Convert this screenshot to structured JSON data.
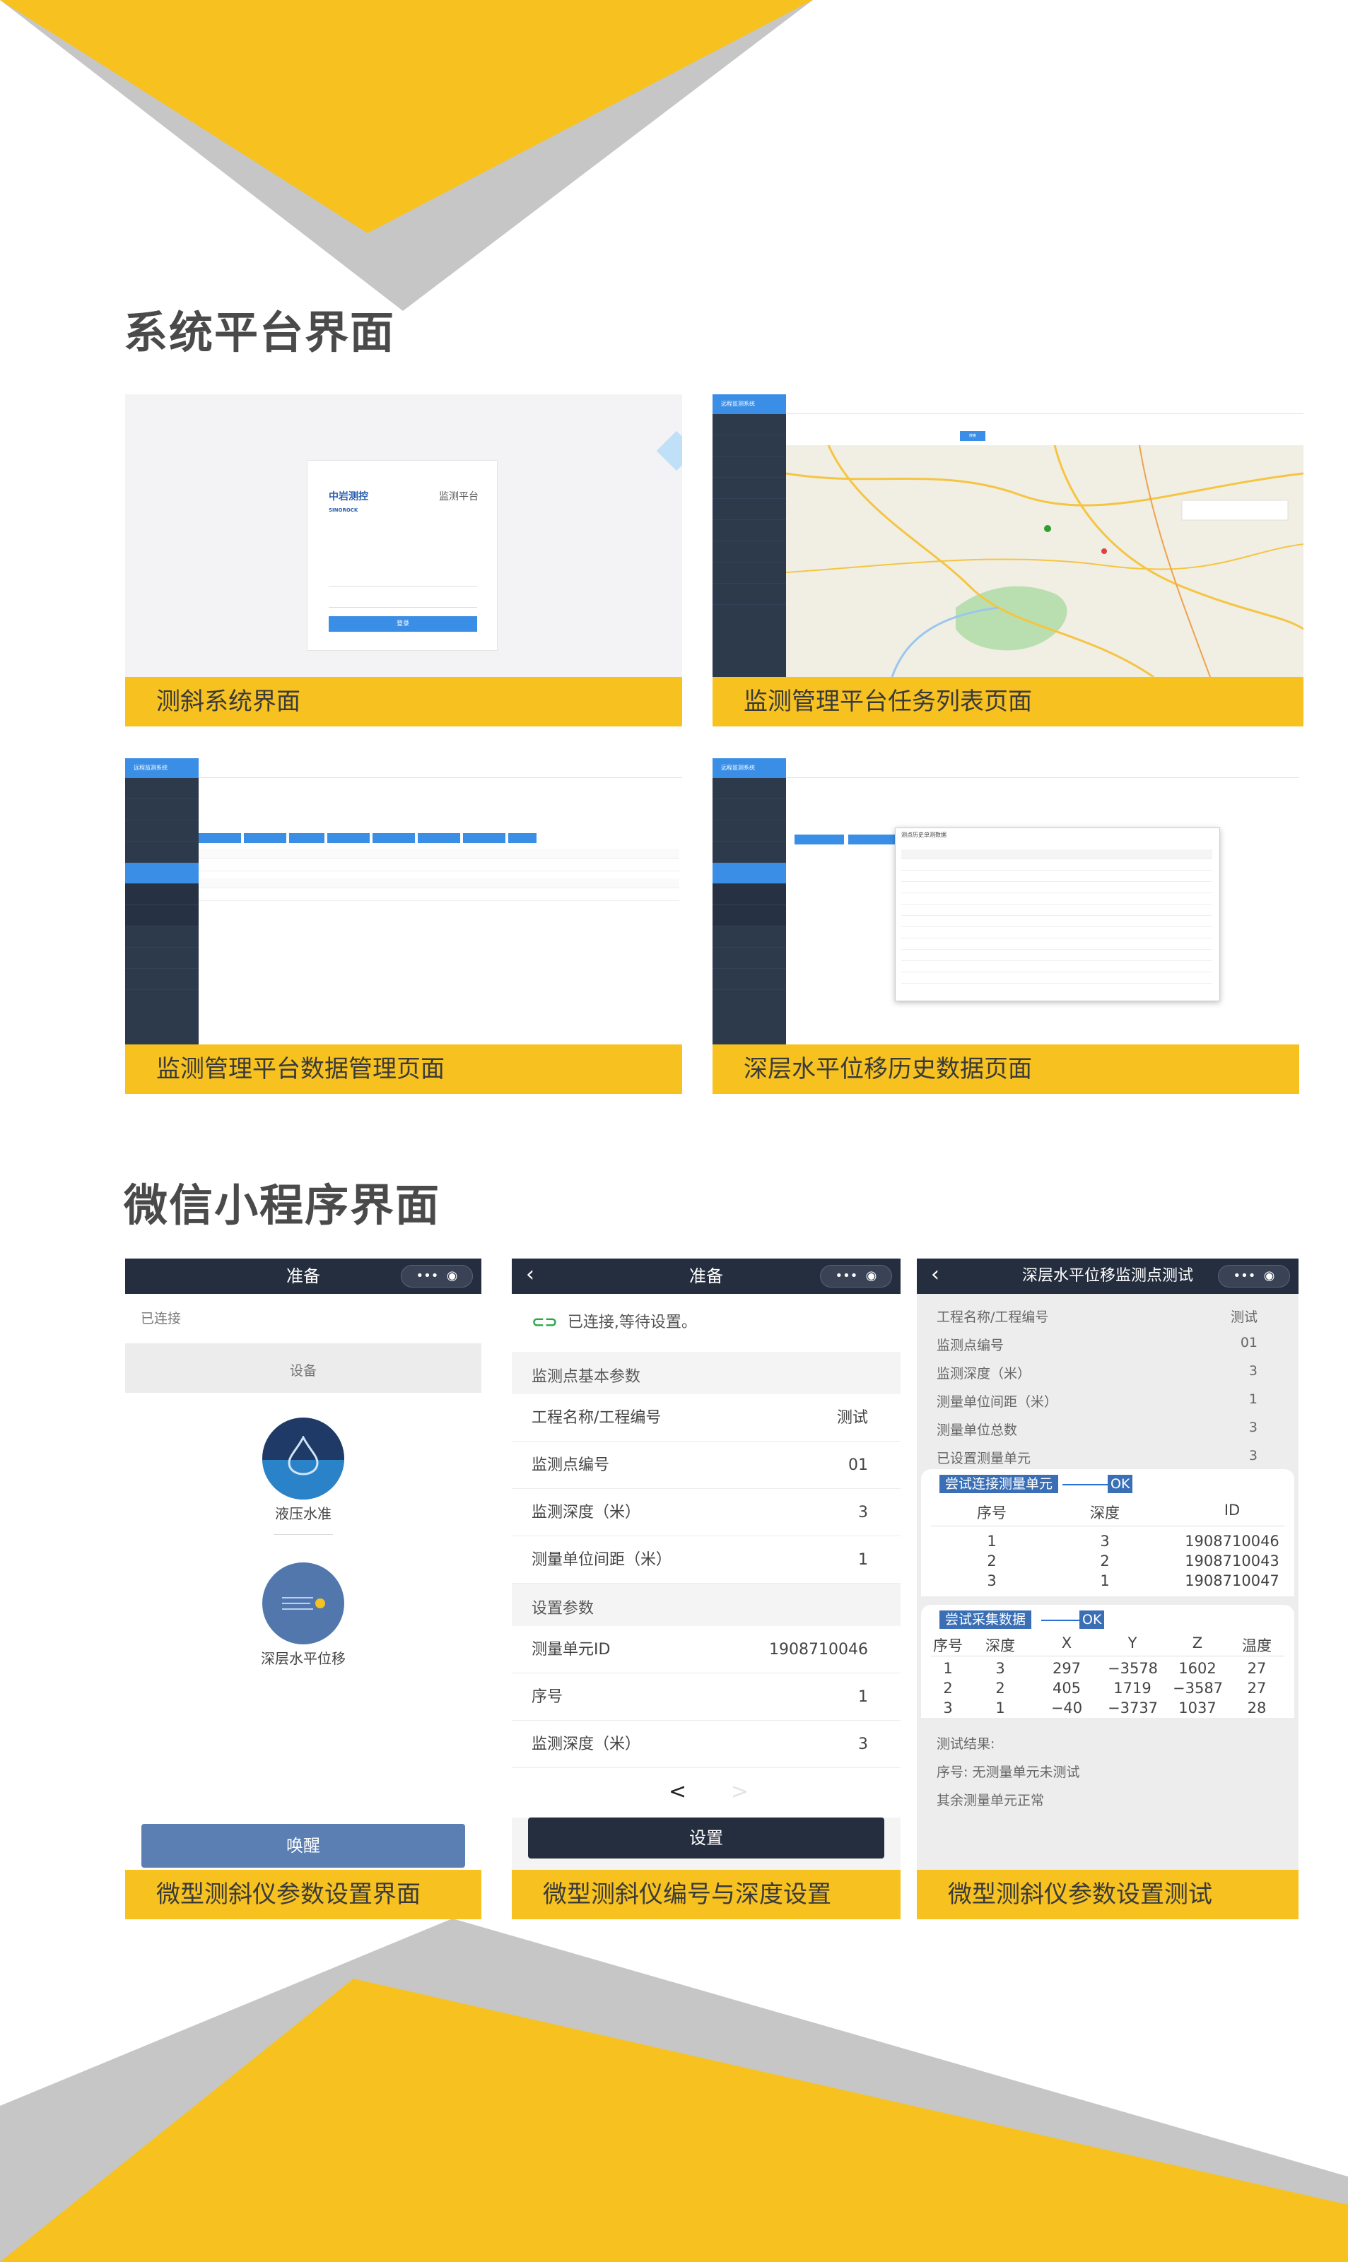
{
  "sections": {
    "platform_title": "系统平台界面",
    "miniapp_title": "微信小程序界面"
  },
  "colors": {
    "accent_yellow": "#f7c220",
    "dark_nav": "#252e3f",
    "blue": "#3a8ee6",
    "gray_deco": "#c8c8c8"
  },
  "platform": {
    "card1": {
      "caption": "测斜系统界面",
      "login_brand": "中岩测控",
      "login_brand_en": "SINOROCK",
      "login_title": "监测平台",
      "login_button": "登录"
    },
    "card2": {
      "caption": "监测管理平台任务列表页面",
      "system_name": "远程监测系统",
      "search_button": "搜索"
    },
    "card3": {
      "caption": "监测管理平台数据管理页面",
      "system_name": "远程监测系统"
    },
    "card4": {
      "caption": "深层水平位移历史数据页面",
      "system_name": "远程监测系统",
      "dialog_title": "测点历史单测数据"
    }
  },
  "miniapp": {
    "phone1": {
      "title": "准备",
      "status": "已连接",
      "group_label": "设备",
      "device1_label": "液压水准",
      "device2_label": "深层水平位移",
      "wake_button": "唤醒",
      "caption": "微型测斜仪参数设置界面"
    },
    "phone2": {
      "title": "准备",
      "status": "已连接,等待设置。",
      "group1": "监测点基本参数",
      "rows1": [
        {
          "label": "工程名称/工程编号",
          "value": "测试"
        },
        {
          "label": "监测点编号",
          "value": "01"
        },
        {
          "label": "监测深度（米）",
          "value": "3"
        },
        {
          "label": "测量单位间距（米）",
          "value": "1"
        }
      ],
      "group2": "设置参数",
      "rows2": [
        {
          "label": "测量单元ID",
          "value": "1908710046"
        },
        {
          "label": "序号",
          "value": "1"
        },
        {
          "label": "监测深度（米）",
          "value": "3"
        }
      ],
      "pager_prev": "<",
      "pager_next": ">",
      "set_button": "设置",
      "caption": "微型测斜仪编号与深度设置"
    },
    "phone3": {
      "title": "深层水平位移监测点测试",
      "rows": [
        {
          "label": "工程名称/工程编号",
          "value": "测试"
        },
        {
          "label": "监测点编号",
          "value": "01"
        },
        {
          "label": "监测深度（米）",
          "value": "3"
        },
        {
          "label": "测量单位间距（米）",
          "value": "1"
        },
        {
          "label": "测量单位总数",
          "value": "3"
        },
        {
          "label": "已设置测量单元",
          "value": "3"
        }
      ],
      "connect_tag": "尝试连接测量单元",
      "connect_ok": "OK",
      "connect_headers": [
        "序号",
        "深度",
        "ID"
      ],
      "connect_rows": [
        [
          "1",
          "3",
          "1908710046"
        ],
        [
          "2",
          "2",
          "1908710043"
        ],
        [
          "3",
          "1",
          "1908710047"
        ]
      ],
      "collect_tag": "尝试采集数据",
      "collect_ok": "OK",
      "collect_headers": [
        "序号",
        "深度",
        "X",
        "Y",
        "Z",
        "温度"
      ],
      "collect_rows": [
        [
          "1",
          "3",
          "297",
          "−3578",
          "1602",
          "27"
        ],
        [
          "2",
          "2",
          "405",
          "1719",
          "−3587",
          "27"
        ],
        [
          "3",
          "1",
          "−40",
          "−3737",
          "1037",
          "28"
        ]
      ],
      "result_label": "测试结果:",
      "result_line1": "序号: 无测量单元未测试",
      "result_line2": "其余测量单元正常",
      "caption": "微型测斜仪参数设置测试"
    }
  }
}
